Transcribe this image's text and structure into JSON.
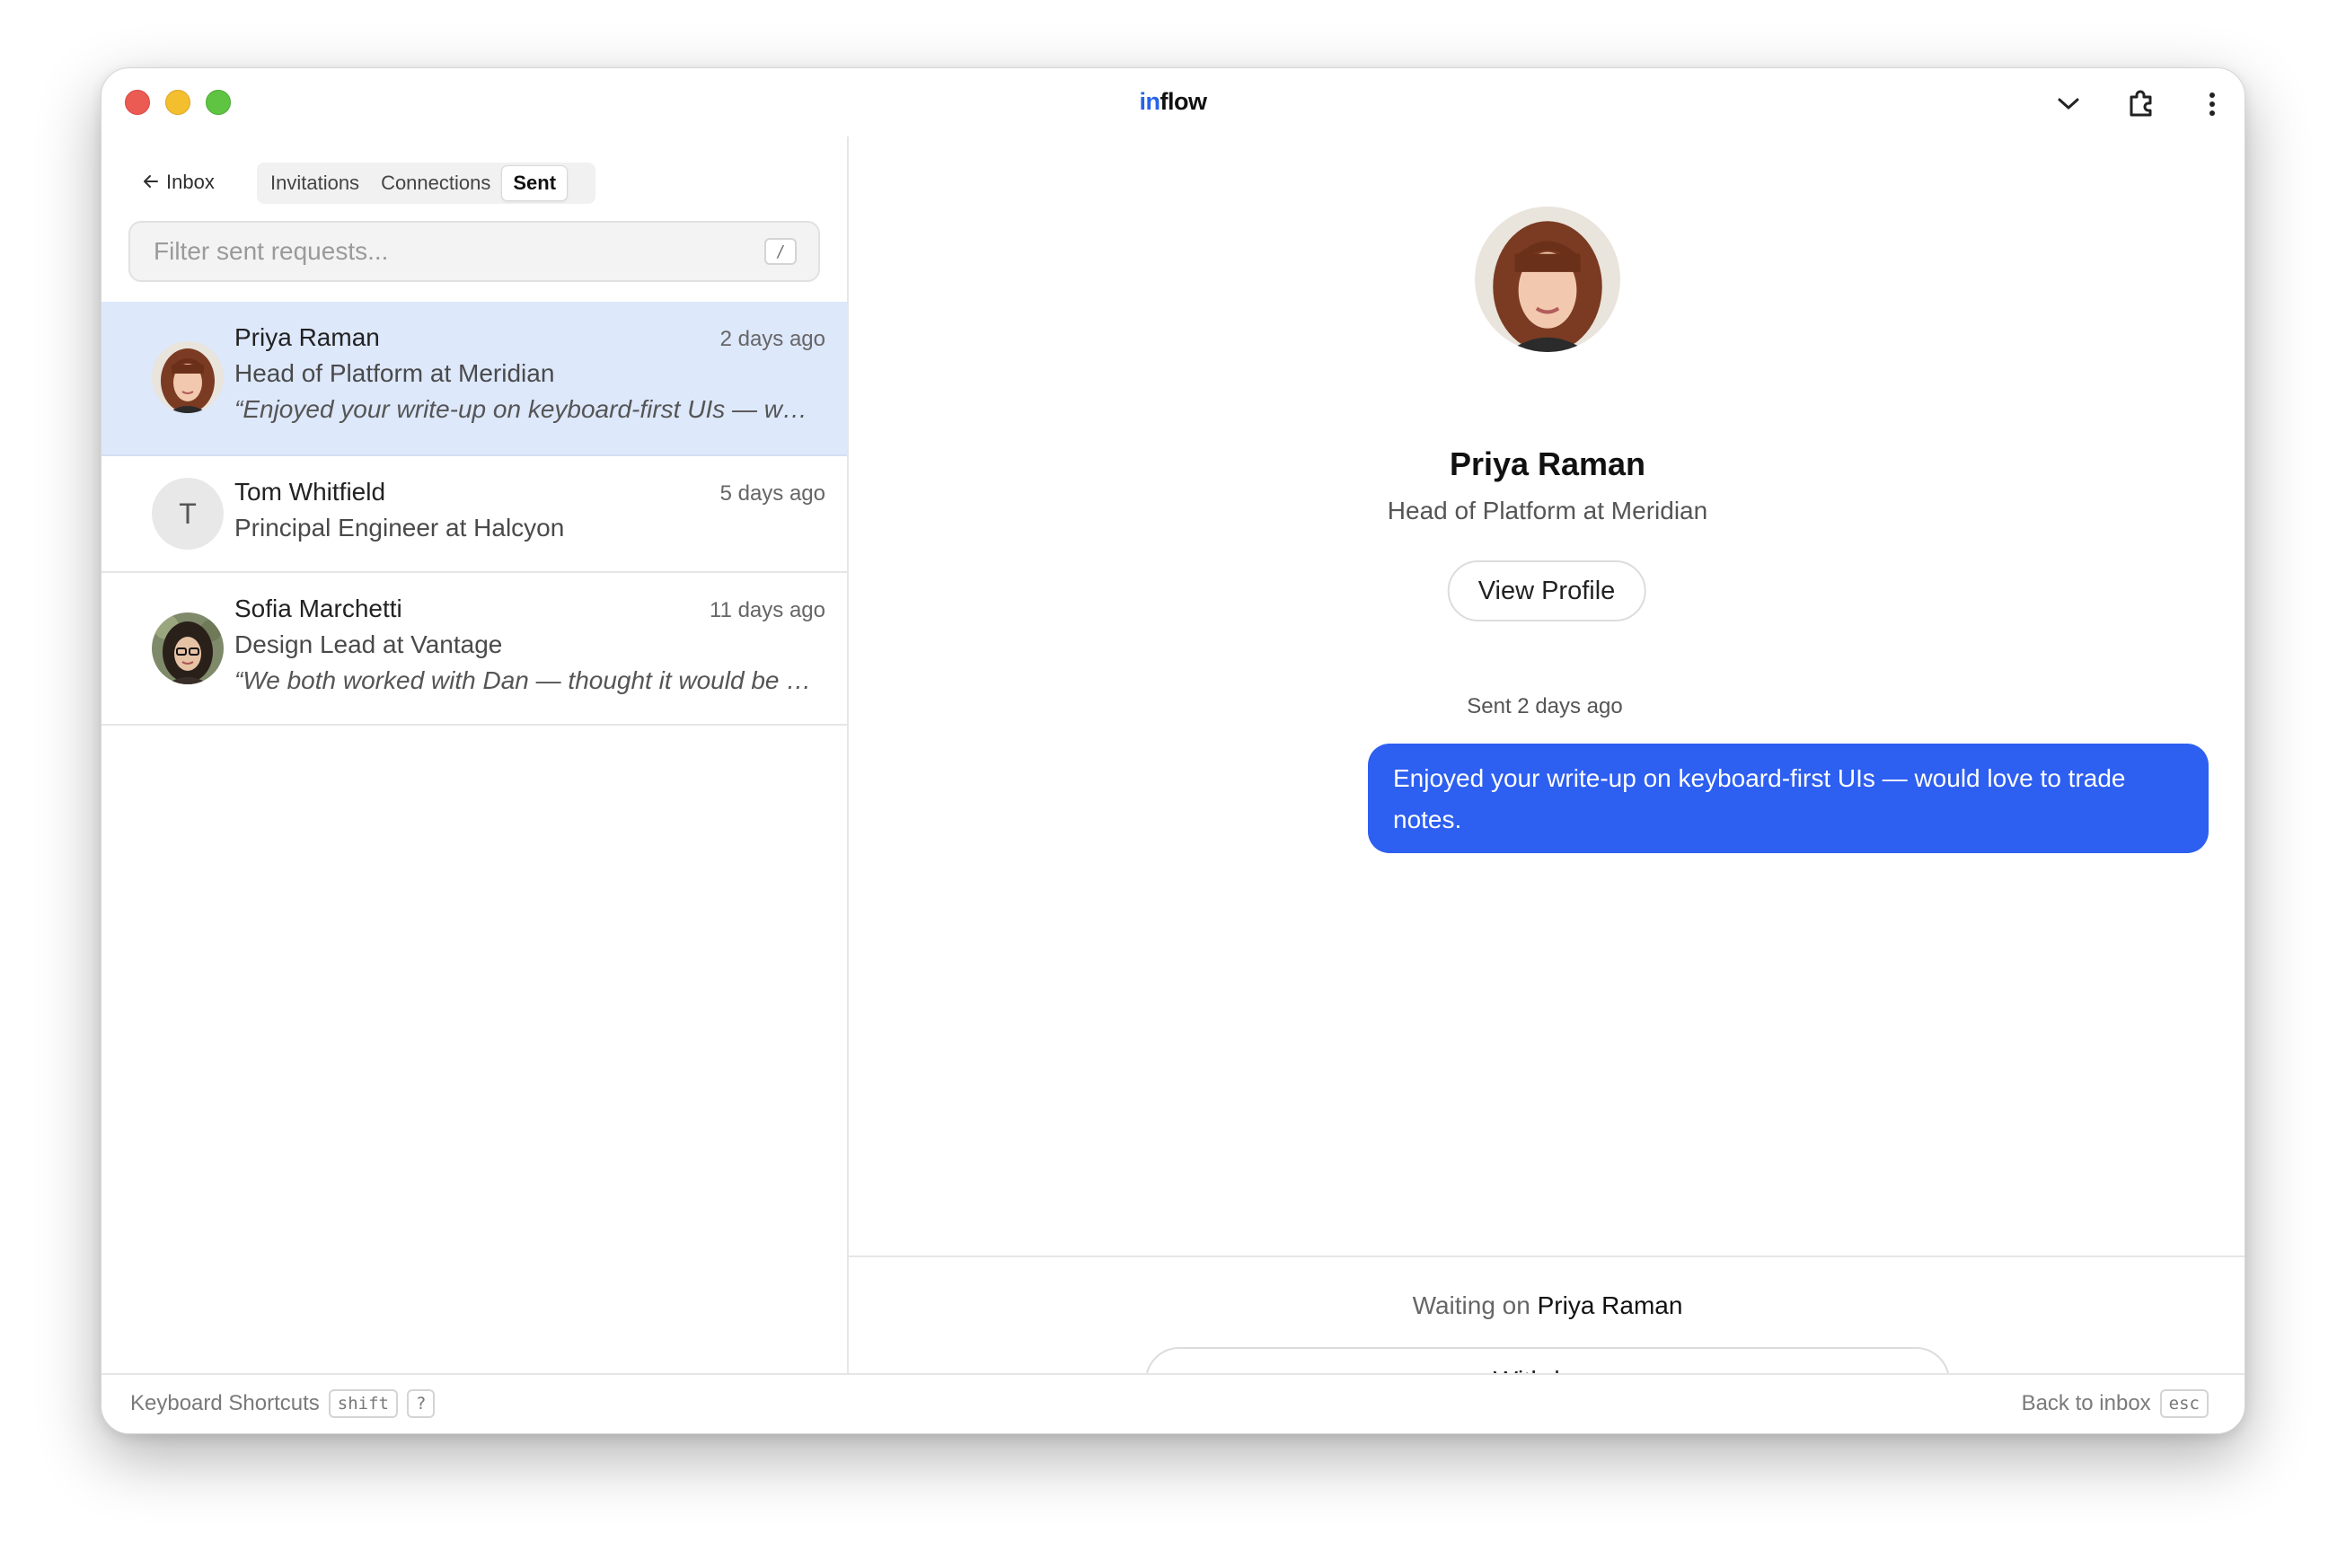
{
  "app": {
    "title_in": "in",
    "title_flow": "flow"
  },
  "nav": {
    "back_label": "Inbox",
    "tabs": [
      {
        "label": "Invitations"
      },
      {
        "label": "Connections"
      },
      {
        "label": "Sent"
      }
    ],
    "active_tab": "Sent"
  },
  "filter": {
    "placeholder": "Filter sent requests...",
    "value": "",
    "shortcut": "/"
  },
  "requests": [
    {
      "name": "Priya Raman",
      "title": "Head of Platform at Meridian",
      "time": "2 days ago",
      "quote": "“Enjoyed your write-up on keyboard-first UIs — would love to trade notes.”",
      "selected": true
    },
    {
      "name": "Tom Whitfield",
      "title": "Principal Engineer at Halcyon",
      "time": "5 days ago",
      "initial": "T"
    },
    {
      "name": "Sofia Marchetti",
      "title": "Design Lead at Vantage",
      "time": "11 days ago",
      "quote": "“We both worked with Dan — thought it would be great to connect.”"
    }
  ],
  "detail": {
    "name": "Priya Raman",
    "title": "Head of Platform at Meridian",
    "view_profile_label": "View Profile",
    "sent_label": "Sent 2 days ago",
    "message": "Enjoyed your write-up on keyboard-first UIs — would love to trade notes.",
    "waiting_prefix": "Waiting on",
    "waiting_name": "Priya Raman",
    "withdraw_label": "Withdraw"
  },
  "statusbar": {
    "shortcuts_label": "Keyboard Shortcuts",
    "shortcuts_keys": [
      "shift",
      "?"
    ],
    "back_label": "Back to inbox",
    "back_key": "esc"
  },
  "colors": {
    "accent": "#2563eb",
    "bubble": "#2d5ff0",
    "selected_row": "#dde8fb"
  }
}
